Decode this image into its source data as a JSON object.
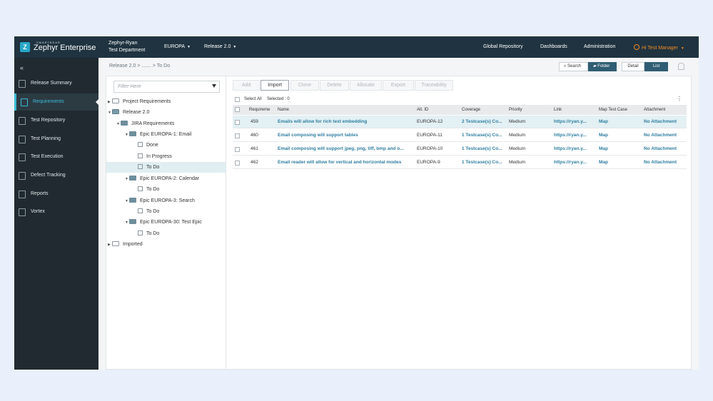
{
  "header": {
    "brand_small": "SMARTBEAR",
    "brand": "Zephyr Enterprise",
    "project_name": "Zephyr-Ryan",
    "project_dept": "Test Department",
    "project_select": "EUROPA",
    "release_select": "Release 2.0",
    "nav": [
      "Global Repository",
      "Dashboards",
      "Administration"
    ],
    "user": "Hi Test Manager"
  },
  "sidebar": {
    "collapse": "«",
    "items": [
      {
        "label": "Release Summary",
        "icon": "release-summary-icon"
      },
      {
        "label": "Requirements",
        "icon": "requirements-icon",
        "active": true
      },
      {
        "label": "Test Repository",
        "icon": "test-repository-icon"
      },
      {
        "label": "Test Planning",
        "icon": "test-planning-icon"
      },
      {
        "label": "Test Execution",
        "icon": "test-execution-icon"
      },
      {
        "label": "Defect Tracking",
        "icon": "defect-tracking-icon"
      },
      {
        "label": "Reports",
        "icon": "reports-icon"
      },
      {
        "label": "Vortex",
        "icon": "vortex-icon"
      }
    ]
  },
  "breadcrumb": "Release 2.0 > ....... > To Do",
  "view": {
    "search": "Search",
    "folder": "Folder",
    "detail": "Detail",
    "list": "List"
  },
  "tree": {
    "filter_placeholder": "Filter Here",
    "nodes": [
      {
        "label": "Project Requirements"
      },
      {
        "label": "Release 2.0"
      },
      {
        "label": "JIRA Requirements"
      },
      {
        "label": "Epic EUROPA-1: Email"
      },
      {
        "label": "Done"
      },
      {
        "label": "In Progress"
      },
      {
        "label": "To Do"
      },
      {
        "label": "Epic EUROPA-2: Calendar"
      },
      {
        "label": "To Do"
      },
      {
        "label": "Epic EUROPA-3: Search"
      },
      {
        "label": "To Do"
      },
      {
        "label": "Epic EUROPA-30: Test Epic"
      },
      {
        "label": "To Do"
      },
      {
        "label": "Imported"
      }
    ]
  },
  "toolbar": {
    "buttons": [
      "Add",
      "Import",
      "Clone",
      "Delete",
      "Allocate",
      "Export",
      "Traceability"
    ]
  },
  "selection": {
    "select_all": "Select All",
    "selected": "Selected : 0"
  },
  "table": {
    "columns": [
      "Requireme",
      "Name",
      "Alt. ID",
      "Coverage",
      "Priority",
      "Link",
      "Map Test Case",
      "Attachment"
    ],
    "rows": [
      {
        "id": "459",
        "name": "Emails will allow for rich text embedding",
        "alt": "EUROPA-12",
        "coverage": "2 Testcase(s) Co...",
        "priority": "Medium",
        "link": "https://ryan.y...",
        "map": "Map",
        "attachment": "No Attachment"
      },
      {
        "id": "460",
        "name": "Email composing will support tables",
        "alt": "EUROPA-11",
        "coverage": "1 Testcase(s) Co...",
        "priority": "Medium",
        "link": "https://ryan.y...",
        "map": "Map",
        "attachment": "No Attachment"
      },
      {
        "id": "461",
        "name": "Email composing will support jpeg, png, tiff, bmp and o...",
        "alt": "EUROPA-10",
        "coverage": "1 Testcase(s) Co...",
        "priority": "Medium",
        "link": "https://ryan.y...",
        "map": "Map",
        "attachment": "No Attachment"
      },
      {
        "id": "462",
        "name": "Email reader will allow for vertical and horizontal modes",
        "alt": "EUROPA-9",
        "coverage": "1 Testcase(s) Co...",
        "priority": "Medium",
        "link": "https://ryan.y...",
        "map": "Map",
        "attachment": "No Attachment"
      }
    ]
  },
  "colors": {
    "topbar": "#1f3340",
    "sidebar": "#202a30",
    "accent": "#3bbbd6",
    "user": "#f08a24",
    "link": "#2f7ea1"
  }
}
